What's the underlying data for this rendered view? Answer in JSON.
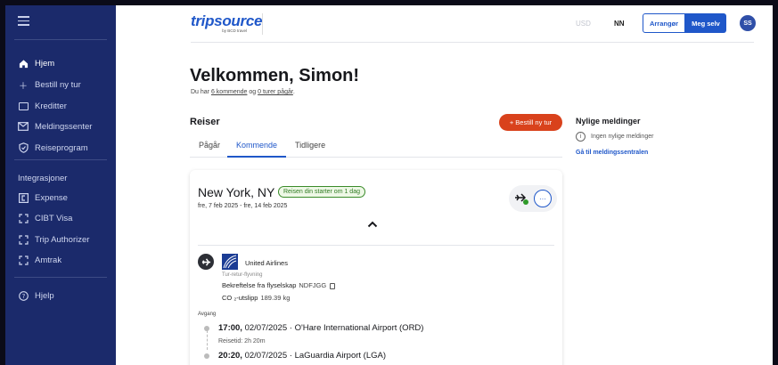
{
  "sidebar": {
    "items": [
      {
        "label": "Hjem",
        "icon": "home-icon"
      },
      {
        "label": "Bestill ny tur",
        "icon": "plus-icon"
      },
      {
        "label": "Kreditter",
        "icon": "credit-icon"
      },
      {
        "label": "Meldingssenter",
        "icon": "mail-icon"
      },
      {
        "label": "Reiseprogram",
        "icon": "shield-icon"
      }
    ],
    "section_title": "Integrasjoner",
    "integrations": [
      {
        "label": "Expense",
        "icon": "expense-icon"
      },
      {
        "label": "CIBT Visa",
        "icon": "frame-icon"
      },
      {
        "label": "Trip Authorizer",
        "icon": "frame-icon"
      },
      {
        "label": "Amtrak",
        "icon": "frame-icon"
      }
    ],
    "help": {
      "label": "Hjelp",
      "icon": "help-icon"
    }
  },
  "header": {
    "logo_text": "tripsource",
    "logo_sub": "by BCD travel",
    "currency": "USD",
    "user_code": "NN",
    "btn_arranger": "Arrangør",
    "btn_meg_selv": "Meg selv",
    "avatar": "SS"
  },
  "main": {
    "welcome": "Velkommen, Simon!",
    "sub_prefix": "Du har ",
    "sub_upcoming": "6 kommende",
    "sub_mid": " og ",
    "sub_ongoing": "0 turer pågår",
    "sub_suffix": ".",
    "trips_title": "Reiser",
    "book_button": "+ Bestill ny tur",
    "tabs": [
      "Pågår",
      "Kommende",
      "Tidligere"
    ]
  },
  "trip": {
    "city": "New York, NY",
    "badge": "Reisen din starter om 1 dag",
    "dates": "fre, 7 feb 2025 - fre, 14 feb 2025",
    "airline": "United Airlines",
    "route_type": "Tur-retur-flyvning",
    "confirmation_label": "Bekreftelse fra flyselskap",
    "confirmation_code": "NDFJGG",
    "co2_label": "CO ₂-utslipp",
    "co2_value": "189.39 kg",
    "departure_label": "Avgang",
    "dep_time": "17:00,",
    "dep_detail": " 02/07/2025 · O'Hare International Airport (ORD)",
    "travel_time": "Reisetid: 2h 20m",
    "arr_time": "20:20,",
    "arr_detail": " 02/07/2025 · LaGuardia Airport (LGA)"
  },
  "messages": {
    "title": "Nylige meldinger",
    "empty": "Ingen nylige meldinger",
    "link": "Gå til meldingssentralen"
  },
  "colors": {
    "sidebar": "#1b2a6b",
    "accent": "#1f57c9",
    "book": "#d9421c"
  }
}
